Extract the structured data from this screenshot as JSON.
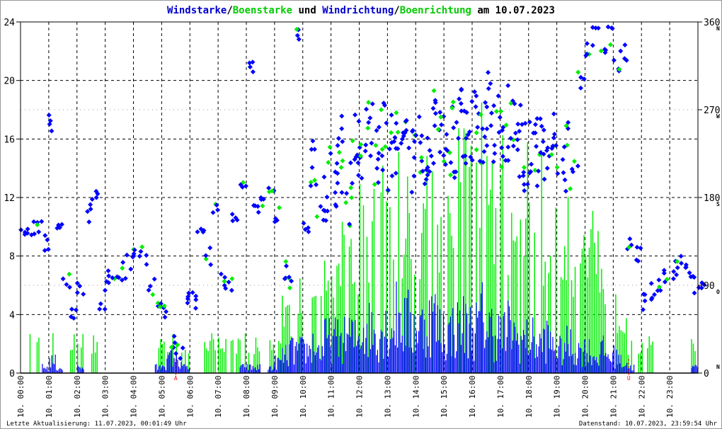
{
  "title_parts": [
    {
      "text": "Windstarke",
      "color": "#0000cc"
    },
    {
      "text": "/",
      "color": "#000000"
    },
    {
      "text": "Boenstarke",
      "color": "#00cc00"
    },
    {
      "text": " und ",
      "color": "#000000"
    },
    {
      "text": "Windrichtung",
      "color": "#0000cc"
    },
    {
      "text": "/",
      "color": "#000000"
    },
    {
      "text": "Boenrichtung",
      "color": "#00cc00"
    },
    {
      "text": " am 10.07.2023",
      "color": "#000000"
    }
  ],
  "footer": {
    "left": "Letzte Aktualisierung: 11.07.2023, 00:01:49 Uhr",
    "right": "Datenstand: 10.07.2023, 23:59:54 Uhr"
  },
  "chart_data": {
    "type": "bar+scatter",
    "title": "Windstarke/Boenstarke und Windrichtung/Boenrichtung am 10.07.2023",
    "left_axis": {
      "range": [
        0,
        24
      ],
      "ticks": [
        "0",
        "4",
        "8",
        "12",
        "16",
        "20",
        "24"
      ]
    },
    "right_axis": {
      "range": [
        0,
        360
      ],
      "ticks": [
        {
          "value": 0,
          "label": "0",
          "dir": "N"
        },
        {
          "value": 90,
          "label": "90",
          "dir": "O"
        },
        {
          "value": 180,
          "label": "180",
          "dir": "S"
        },
        {
          "value": 270,
          "label": "270",
          "dir": "W"
        },
        {
          "value": 360,
          "label": "360",
          "dir": "N"
        }
      ]
    },
    "x_ticks": [
      "10. 00:00",
      "10. 01:00",
      "10. 02:00",
      "10. 03:00",
      "10. 04:00",
      "10. 05:00",
      "10. 06:00",
      "10. 07:00",
      "10. 08:00",
      "10. 09:00",
      "10. 10:00",
      "10. 11:00",
      "10. 12:00",
      "10. 13:00",
      "10. 14:00",
      "10. 15:00",
      "10. 16:00",
      "10. 17:00",
      "10. 18:00",
      "10. 19:00",
      "10. 20:00",
      "10. 21:00",
      "10. 22:00",
      "10. 23:00"
    ],
    "sun_markers": [
      {
        "label": "A",
        "hour": 5.5
      },
      {
        "label": "U",
        "hour": 21.55
      }
    ],
    "interval_minutes": 15,
    "series": [
      {
        "name": "Windstarke",
        "color": "#0000ff",
        "values": [
          0,
          0,
          0,
          0.5,
          1,
          0.5,
          0,
          0,
          0.5,
          0,
          0,
          0,
          0,
          0,
          0,
          0,
          0,
          0,
          0,
          0.5,
          1,
          1.5,
          1,
          0.5,
          0,
          0,
          0,
          0,
          0,
          0,
          0,
          0.5,
          0.5,
          0.5,
          0,
          0.5,
          1,
          1.5,
          2,
          2,
          2,
          2.5,
          2,
          3,
          3,
          3,
          3.5,
          3,
          4,
          4,
          3.5,
          4,
          4,
          5,
          4.5,
          4,
          4,
          4.5,
          5,
          4,
          3.5,
          4,
          4.5,
          4,
          4,
          5,
          4,
          3.5,
          3.5,
          4,
          3,
          3,
          3,
          2.5,
          3,
          2.5,
          2,
          2.5,
          2,
          2,
          2,
          1.5,
          2,
          1.5,
          1.5,
          1,
          0.5,
          0,
          0,
          0,
          0,
          0,
          0,
          0,
          0,
          0.5
        ]
      },
      {
        "name": "Boenstarke",
        "color": "#00ee00",
        "values": [
          0,
          2.5,
          2.5,
          0,
          2.5,
          2.5,
          0,
          2.5,
          2.5,
          0,
          2.5,
          0,
          0,
          0,
          0,
          0,
          0,
          0,
          0,
          2.5,
          2.5,
          2.5,
          2.5,
          2.5,
          0,
          0,
          2.5,
          2.5,
          2.5,
          2.5,
          2.5,
          2.5,
          2.5,
          2.5,
          0,
          2.5,
          2.5,
          5,
          5,
          7.5,
          7.5,
          7.5,
          5,
          7.5,
          7.5,
          10,
          10,
          10,
          12.5,
          10,
          12.5,
          15,
          12.5,
          15,
          12.5,
          12.5,
          12.5,
          15,
          15,
          12.5,
          12.5,
          15,
          17.5,
          15,
          15,
          17.5,
          15,
          12.5,
          15,
          12.5,
          12.5,
          15,
          12.5,
          15,
          10,
          12.5,
          10,
          12.5,
          10,
          10,
          10,
          12.5,
          7.5,
          7.5,
          5,
          5,
          2.5,
          2.5,
          2.5,
          2.5,
          0,
          0,
          0,
          0,
          0,
          2.5
        ]
      },
      {
        "name": "Windrichtung",
        "color": "#0000ff",
        "unit": "deg",
        "values": [
          150,
          150,
          150,
          135,
          255,
          150,
          97,
          60,
          90,
          165,
          180,
          75,
          97,
          90,
          105,
          112,
          127,
          120,
          90,
          75,
          60,
          30,
          22,
          75,
          75,
          150,
          120,
          165,
          97,
          90,
          165,
          195,
          315,
          165,
          180,
          180,
          165,
          105,
          90,
          345,
          150,
          210,
          165,
          195,
          210,
          225,
          180,
          240,
          225,
          240,
          225,
          240,
          225,
          240,
          255,
          225,
          240,
          225,
          255,
          240,
          225,
          240,
          255,
          240,
          255,
          240,
          270,
          255,
          240,
          255,
          240,
          225,
          240,
          225,
          210,
          240,
          210,
          225,
          210,
          300,
          330,
          345,
          330,
          345,
          315,
          330,
          135,
          120,
          75,
          82,
          90,
          97,
          105,
          110,
          105,
          90,
          90
        ]
      }
    ]
  }
}
